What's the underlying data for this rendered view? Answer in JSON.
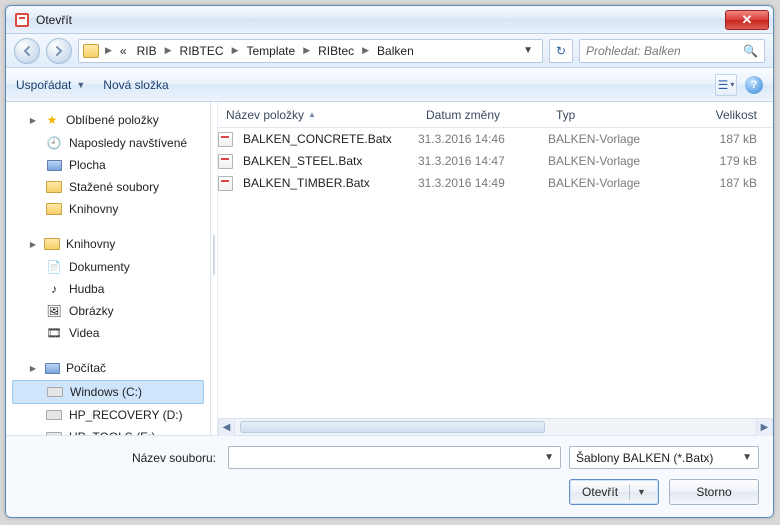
{
  "title": "Otevřít",
  "breadcrumb": {
    "hint": "«",
    "parts": [
      "RIB",
      "RIBTEC",
      "Template",
      "RIBtec",
      "Balken"
    ]
  },
  "search": {
    "placeholder": "Prohledat: Balken"
  },
  "toolbar": {
    "organize": "Uspořádat",
    "new_folder": "Nová složka"
  },
  "columns": {
    "name": "Název položky",
    "date": "Datum změny",
    "type": "Typ",
    "size": "Velikost"
  },
  "files": [
    {
      "name": "BALKEN_CONCRETE.Batx",
      "date": "31.3.2016 14:46",
      "type": "BALKEN-Vorlage",
      "size": "187 kB"
    },
    {
      "name": "BALKEN_STEEL.Batx",
      "date": "31.3.2016 14:47",
      "type": "BALKEN-Vorlage",
      "size": "179 kB"
    },
    {
      "name": "BALKEN_TIMBER.Batx",
      "date": "31.3.2016 14:49",
      "type": "BALKEN-Vorlage",
      "size": "187 kB"
    }
  ],
  "tree": {
    "favorites": {
      "label": "Oblíbené položky",
      "items": [
        "Naposledy navštívené",
        "Plocha",
        "Stažené soubory",
        "Knihovny"
      ]
    },
    "libraries": {
      "label": "Knihovny",
      "items": [
        "Dokumenty",
        "Hudba",
        "Obrázky",
        "Videa"
      ]
    },
    "computer": {
      "label": "Počítač",
      "items": [
        "Windows  (C:)",
        "HP_RECOVERY (D:)",
        "HP_TOOLS (E:)"
      ]
    }
  },
  "form": {
    "filename_label": "Název souboru:",
    "filename_value": "",
    "filter": "Šablony BALKEN (*.Batx)",
    "open": "Otevřít",
    "cancel": "Storno"
  }
}
